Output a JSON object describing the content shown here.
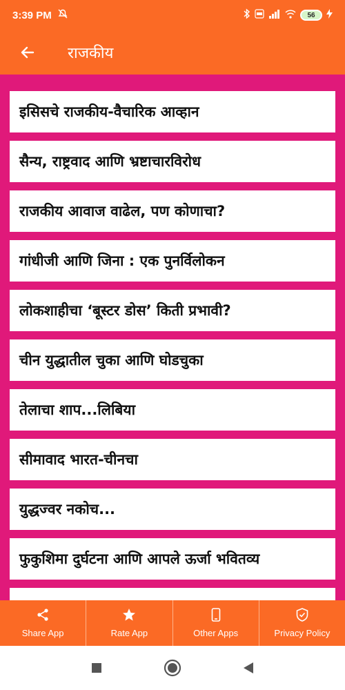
{
  "status_bar": {
    "time": "3:39 PM",
    "battery": "56",
    "icons": [
      "alarm-off-icon",
      "bluetooth-icon",
      "volte-icon",
      "signal-icon",
      "wifi-icon",
      "charging-icon"
    ]
  },
  "app_bar": {
    "title": "राजकीय",
    "back_icon": "arrow-back-icon"
  },
  "colors": {
    "primary": "#fb6a25",
    "list_background": "#e0197a",
    "card": "#ffffff"
  },
  "items": [
    "इसिसचे राजकीय-वैचारिक आव्हान",
    "सैन्य, राष्ट्रवाद आणि भ्रष्टाचारविरोध",
    "राजकीय आवाज वाढेल, पण कोणाचा?",
    "गांधीजी आणि जिना : एक पुनर्विलोकन",
    "लोकशाहीचा ‘बूस्टर डोस’ किती प्रभावी?",
    "चीन युद्धातील चुका आणि घोडचुका",
    "तेलाचा शाप...लिबिया",
    "सीमावाद भारत-चीनचा",
    "युद्धज्वर नकोच...",
    "फुकुशिमा दुर्घटना आणि आपले ऊर्जा भवितव्य"
  ],
  "bottom_nav": [
    {
      "label": "Share App",
      "icon": "share-icon"
    },
    {
      "label": "Rate App",
      "icon": "star-icon"
    },
    {
      "label": "Other Apps",
      "icon": "phone-icon"
    },
    {
      "label": "Privacy Policy",
      "icon": "shield-check-icon"
    }
  ],
  "system_nav": [
    "recents-square-icon",
    "home-circle-icon",
    "back-triangle-icon"
  ]
}
